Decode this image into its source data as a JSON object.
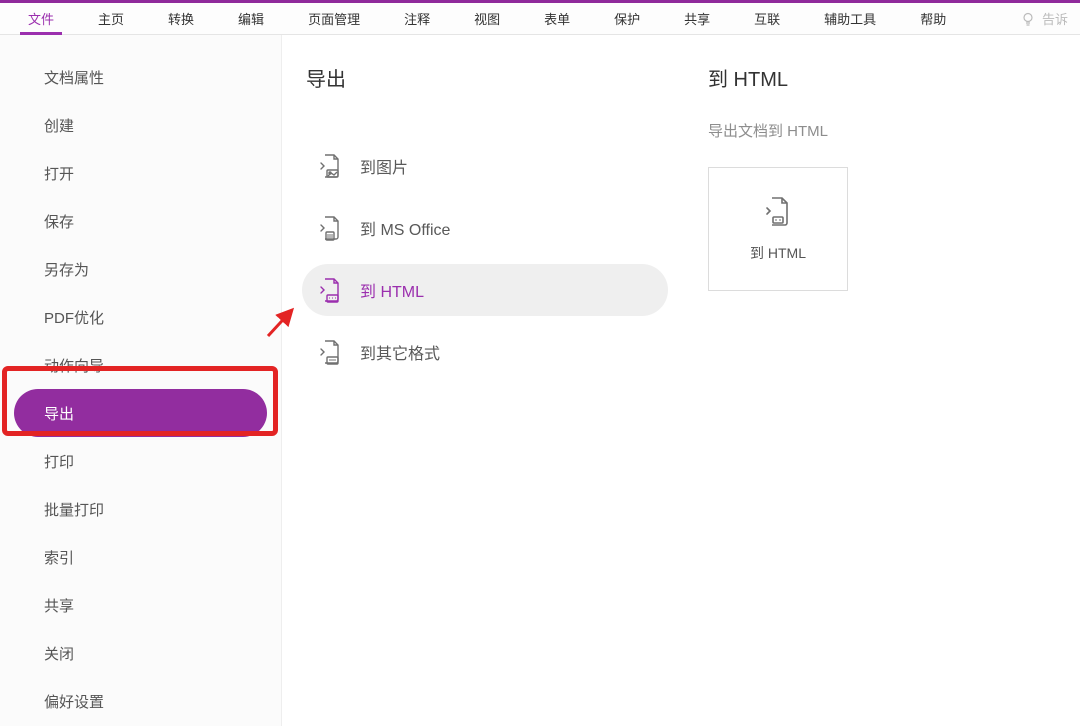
{
  "menubar": {
    "items": [
      {
        "label": "文件",
        "active": true
      },
      {
        "label": "主页",
        "active": false
      },
      {
        "label": "转换",
        "active": false
      },
      {
        "label": "编辑",
        "active": false
      },
      {
        "label": "页面管理",
        "active": false
      },
      {
        "label": "注释",
        "active": false
      },
      {
        "label": "视图",
        "active": false
      },
      {
        "label": "表单",
        "active": false
      },
      {
        "label": "保护",
        "active": false
      },
      {
        "label": "共享",
        "active": false
      },
      {
        "label": "互联",
        "active": false
      },
      {
        "label": "辅助工具",
        "active": false
      },
      {
        "label": "帮助",
        "active": false
      }
    ],
    "tell_me_placeholder": "告诉"
  },
  "sidebar": {
    "items": [
      {
        "label": "文档属性",
        "selected": false
      },
      {
        "label": "创建",
        "selected": false
      },
      {
        "label": "打开",
        "selected": false
      },
      {
        "label": "保存",
        "selected": false
      },
      {
        "label": "另存为",
        "selected": false
      },
      {
        "label": "PDF优化",
        "selected": false
      },
      {
        "label": "动作向导",
        "selected": false
      },
      {
        "label": "导出",
        "selected": true
      },
      {
        "label": "打印",
        "selected": false
      },
      {
        "label": "批量打印",
        "selected": false
      },
      {
        "label": "索引",
        "selected": false
      },
      {
        "label": "共享",
        "selected": false
      },
      {
        "label": "关闭",
        "selected": false
      },
      {
        "label": "偏好设置",
        "selected": false
      }
    ]
  },
  "middle": {
    "title": "导出",
    "options": [
      {
        "label": "到图片",
        "icon": "image-file-icon",
        "selected": false
      },
      {
        "label": "到 MS Office",
        "icon": "office-file-icon",
        "selected": false
      },
      {
        "label": "到 HTML",
        "icon": "html-file-icon",
        "selected": true
      },
      {
        "label": "到其它格式",
        "icon": "other-file-icon",
        "selected": false
      }
    ]
  },
  "right": {
    "title": "到 HTML",
    "description": "导出文档到 HTML",
    "card_label": "到 HTML"
  },
  "annotations": {
    "highlight_target": "导出",
    "arrow_target": "到 HTML"
  }
}
